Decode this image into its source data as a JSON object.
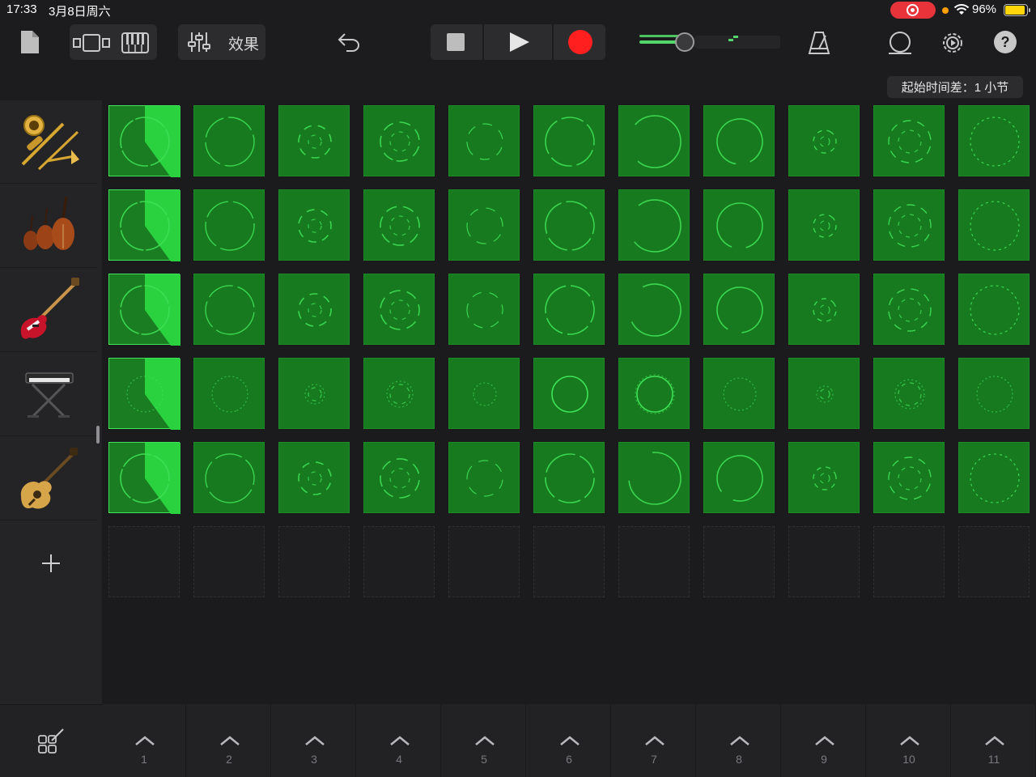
{
  "status_bar": {
    "time": "17:33",
    "date": "3月8日周六",
    "battery_text": "96%",
    "battery_level": 0.96
  },
  "toolbar": {
    "effects_label": "效果",
    "volume_level": 0.55,
    "accent_color": "#53d769",
    "record_color": "#ff1f1f"
  },
  "subbar": {
    "start_offset_label": "起始时间差：1 小节"
  },
  "tracks": [
    {
      "name": "Brass",
      "icon": "brass-icon"
    },
    {
      "name": "Strings",
      "icon": "strings-icon"
    },
    {
      "name": "Bass",
      "icon": "electric-bass-icon"
    },
    {
      "name": "Keyboard",
      "icon": "keyboard-icon"
    },
    {
      "name": "Acoustic Guitar",
      "icon": "acoustic-guitar-icon"
    }
  ],
  "grid": {
    "columns": 11,
    "rows": 5,
    "playing_column": 1,
    "cell_color": "#177a1f",
    "playing_fill_color": "#2bd23f"
  },
  "scenes": [
    "1",
    "2",
    "3",
    "4",
    "5",
    "6",
    "7",
    "8",
    "9",
    "10",
    "11"
  ]
}
